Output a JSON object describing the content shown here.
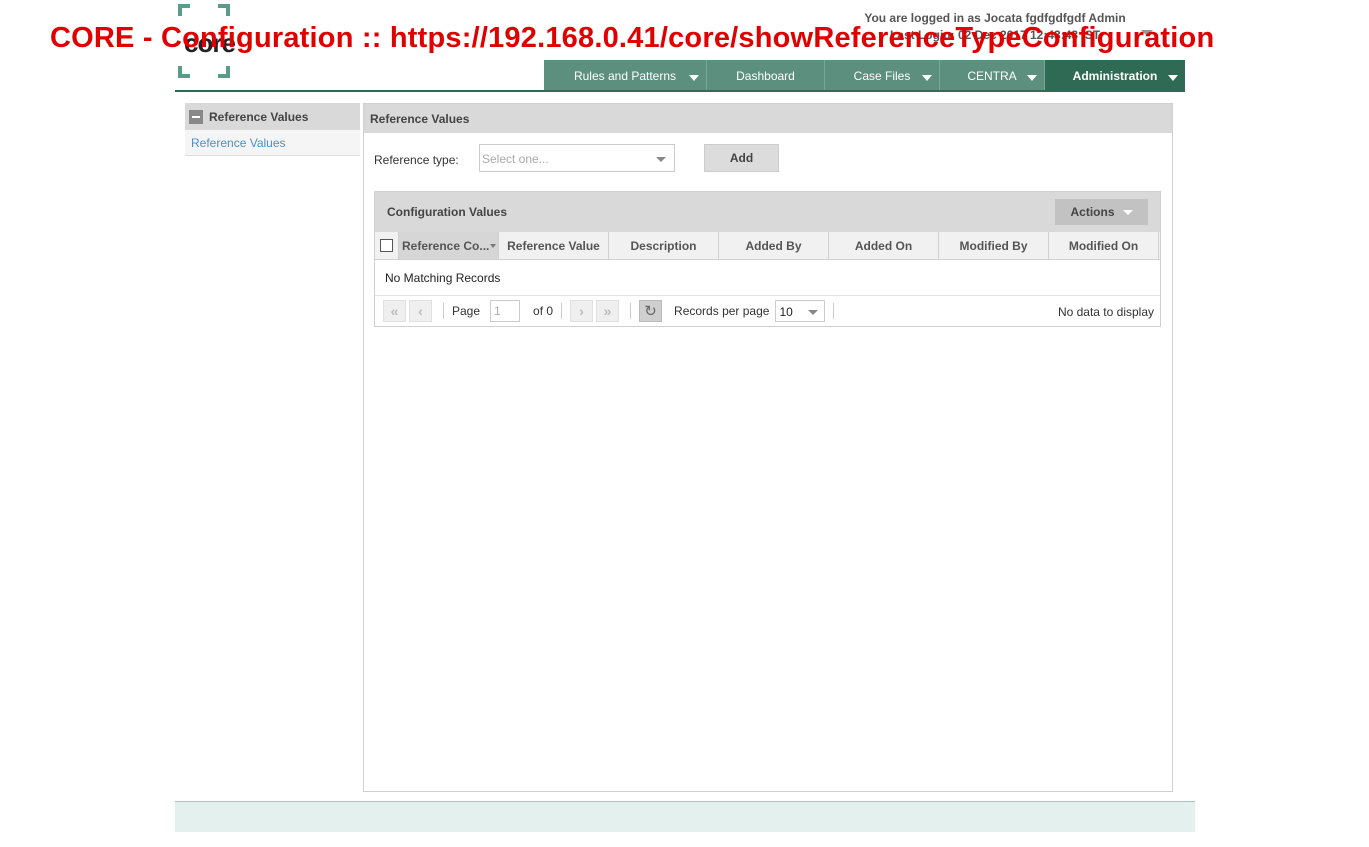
{
  "window": {
    "title": "CORE - Configuration :: https://192.168.0.41/core/showReferenceTypeConfiguration"
  },
  "brand": {
    "logo_text": "core",
    "accent": "#2f6a55"
  },
  "user": {
    "logged_in": "You are logged in as Jocata fgdfgdfgdf Admin",
    "last_login": "Last Login: 02 Dec 2017 12:43:43 IST"
  },
  "nav": {
    "items": [
      {
        "label": "Rules and Patterns",
        "has_menu": true
      },
      {
        "label": "Dashboard",
        "has_menu": false
      },
      {
        "label": "Case Files",
        "has_menu": true
      },
      {
        "label": "CENTRA",
        "has_menu": true
      },
      {
        "label": "Administration",
        "has_menu": true,
        "active": true
      }
    ]
  },
  "sidebar": {
    "header": "Reference Values",
    "items": [
      {
        "label": "Reference Values"
      }
    ]
  },
  "main": {
    "header": "Reference Values",
    "reference_type_label": "Reference type:",
    "reference_type_placeholder": "Select one...",
    "add_label": "Add"
  },
  "grid": {
    "title": "Configuration Values",
    "actions_label": "Actions",
    "columns": [
      "Reference Co...",
      "Reference Value",
      "Description",
      "Added By",
      "Added On",
      "Modified By",
      "Modified On"
    ],
    "empty_message": "No Matching Records",
    "pager": {
      "page_label": "Page",
      "page_value": "1",
      "of_label": "of 0",
      "records_per_page_label": "Records per page",
      "records_per_page_value": "10",
      "status": "No data to display"
    }
  }
}
